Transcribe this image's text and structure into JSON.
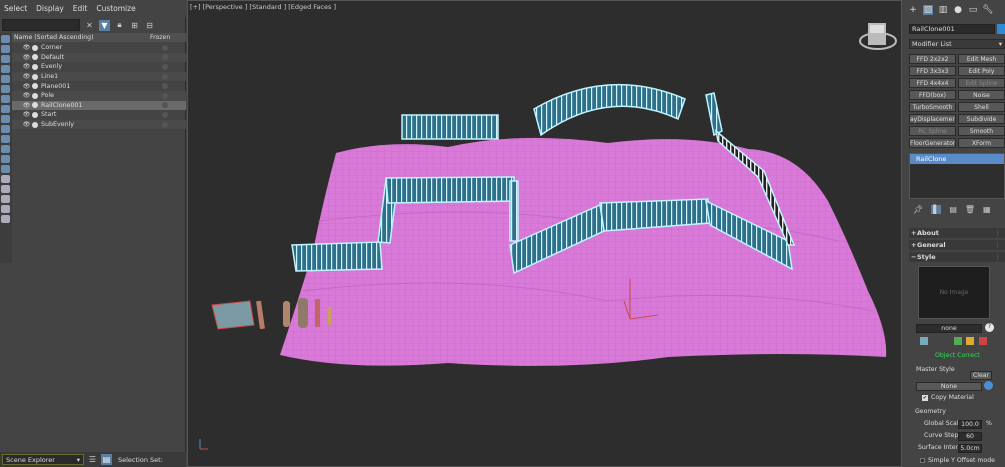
{
  "menu": [
    "Select",
    "Display",
    "Edit",
    "Customize"
  ],
  "scene_explorer": {
    "column_name": "Name (Sorted Ascending)",
    "column_frozen": "Frozen",
    "rows": [
      "Corner",
      "Default",
      "Evenly",
      "Line1",
      "Plane001",
      "Pole",
      "RailClone001",
      "Start",
      "SubEvenly"
    ],
    "selected_row": "RailClone001",
    "bottom_dropdown": "Scene Explorer",
    "selection_set_label": "Selection Set:"
  },
  "viewport": {
    "label": "[+] [Perspective ] [Standard ] [Edged Faces ]",
    "colors": {
      "plane": "#d97ad9",
      "fence": "#2f7a96",
      "outline": "#bff4ff",
      "background": "#2d2d2d"
    }
  },
  "command_panel": {
    "object_name": "RailClone001",
    "modifier_list": "Modifier List",
    "modifiers": [
      "FFD 2x2x2",
      "Edit Mesh",
      "FFD 3x3x3",
      "Edit Poly",
      "FFD 4x4x4",
      "Edit Spline",
      "FFD(box)",
      "Noise",
      "TurboSmooth",
      "Shell",
      "ayDisplacementM",
      "Subdivide",
      "RC Spline",
      "Smooth",
      "FloorGenerator",
      "XForm"
    ],
    "disabled_modifiers": [
      "Edit Spline",
      "RC Spline"
    ],
    "stack_item": "RailClone",
    "rollouts": {
      "about": "About",
      "general": "General",
      "style": "Style"
    },
    "preview_text": "No Image",
    "style_field": "none",
    "status": "Object Correct",
    "master_style_label": "Master Style",
    "clear_button": "Clear",
    "master_style_value": "None",
    "copy_material": "Copy Material",
    "geometry_label": "Geometry",
    "global_scale_label": "Global Scale",
    "global_scale_value": "100.0",
    "global_scale_unit": "%",
    "curve_steps_label": "Curve Steps",
    "curve_steps_value": "60",
    "surface_interp_label": "Surface Interp.",
    "surface_interp_value": "5.0cm",
    "simple_y_offset": "Simple Y Offset mode"
  }
}
